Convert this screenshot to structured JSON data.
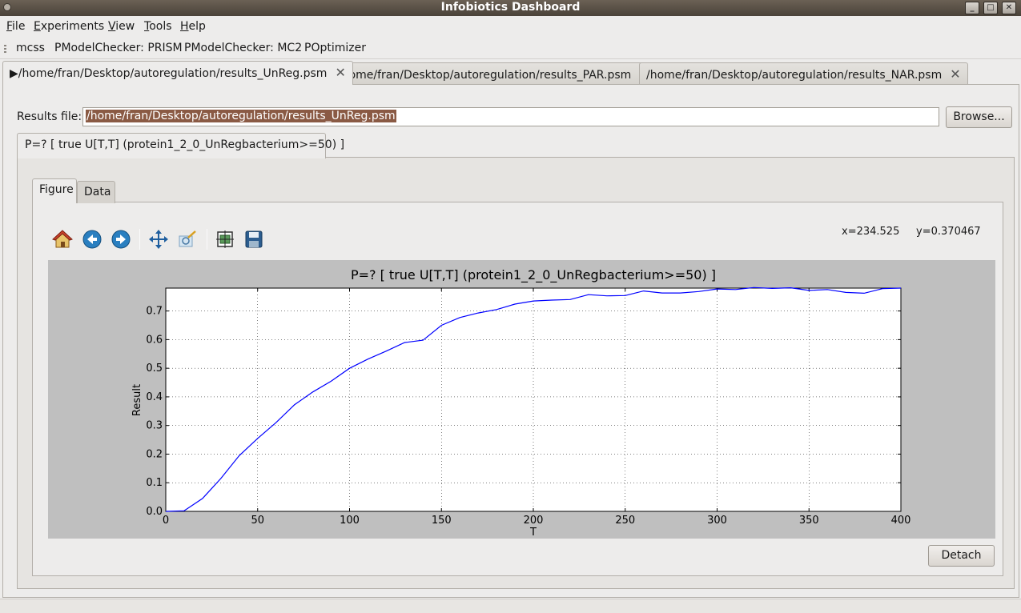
{
  "window": {
    "title": "Infobiotics Dashboard",
    "controls": [
      "_",
      "□",
      "✕"
    ]
  },
  "menu": {
    "file": {
      "accel": "F",
      "rest": "ile"
    },
    "experiments": {
      "accel": "E",
      "rest": "xperiments"
    },
    "view": {
      "accel": "V",
      "rest": "iew"
    },
    "tools": {
      "accel": "T",
      "rest": "ools"
    },
    "help": {
      "accel": "H",
      "rest": "elp"
    }
  },
  "toolbar": {
    "items": [
      "mcss",
      "PModelChecker: PRISM",
      "PModelChecker: MC2",
      "POptimizer"
    ]
  },
  "file_tabs": [
    {
      "label": "/home/fran/Desktop/autoregulation/results_UnReg.psm",
      "marker": "▶",
      "active": true
    },
    {
      "label": "/home/fran/Desktop/autoregulation/results_PAR.psm",
      "active": false
    },
    {
      "label": "/home/fran/Desktop/autoregulation/results_NAR.psm",
      "active": false
    }
  ],
  "results": {
    "label": "Results file:",
    "value": "/home/fran/Desktop/autoregulation/results_UnReg.psm",
    "browse_label": "Browse..."
  },
  "property_tab": {
    "label": "P=? [ true U[T,T] (protein1_2_0_UnRegbacterium>=50) ]"
  },
  "subtabs": {
    "figure": "Figure",
    "data": "Data"
  },
  "nav_icons": [
    "home-icon",
    "back-icon",
    "forward-icon",
    "pan-icon",
    "zoom-rect-icon",
    "configure-subplots-icon",
    "save-icon"
  ],
  "coords": {
    "x": "x=234.525",
    "y": "y=0.370467"
  },
  "detach_label": "Detach",
  "colors": {
    "line": "#0000ff",
    "plot_bg": "#bfbfbf",
    "selection": "#8a5a44"
  },
  "chart_data": {
    "type": "line",
    "title": "P=? [ true U[T,T] (protein1_2_0_UnRegbacterium>=50) ]",
    "xlabel": "T",
    "ylabel": "Result",
    "xlim": [
      0,
      400
    ],
    "ylim": [
      0,
      0.78
    ],
    "xticks": [
      0,
      50,
      100,
      150,
      200,
      250,
      300,
      350,
      400
    ],
    "yticks": [
      0.0,
      0.1,
      0.2,
      0.3,
      0.4,
      0.5,
      0.6,
      0.7
    ],
    "grid": true,
    "series": [
      {
        "x": [
          0,
          10,
          20,
          30,
          40,
          50,
          60,
          70,
          80,
          90,
          100,
          110,
          120,
          130,
          140,
          150,
          160,
          170,
          180,
          190,
          200,
          210,
          220,
          230,
          240,
          250,
          260,
          270,
          280,
          290,
          300,
          310,
          320,
          330,
          340,
          350,
          360,
          370,
          380,
          390,
          400
        ],
        "y": [
          0.0,
          0.002,
          0.045,
          0.115,
          0.195,
          0.255,
          0.31,
          0.372,
          0.417,
          0.455,
          0.5,
          0.532,
          0.56,
          0.59,
          0.598,
          0.65,
          0.677,
          0.693,
          0.705,
          0.724,
          0.735,
          0.738,
          0.74,
          0.757,
          0.753,
          0.754,
          0.77,
          0.763,
          0.763,
          0.768,
          0.777,
          0.775,
          0.782,
          0.779,
          0.781,
          0.772,
          0.775,
          0.765,
          0.762,
          0.778,
          0.78
        ]
      }
    ]
  }
}
